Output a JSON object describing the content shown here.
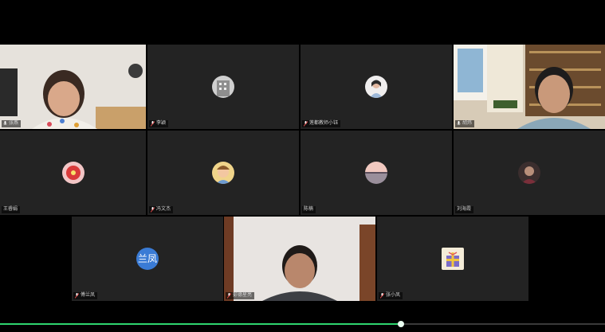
{
  "participants": [
    {
      "name": "张燕",
      "muted": false,
      "type": "video"
    },
    {
      "name": "李颖",
      "muted": true,
      "type": "avatar",
      "icon": "building-avatar"
    },
    {
      "name": "莲都教师小钰",
      "muted": true,
      "type": "avatar",
      "icon": "woman-photo-avatar"
    },
    {
      "name": "胡炜",
      "muted": false,
      "type": "video"
    },
    {
      "name": "王睿娟",
      "muted": false,
      "type": "avatar",
      "icon": "red-flower-avatar"
    },
    {
      "name": "冯文杰",
      "muted": true,
      "type": "avatar",
      "icon": "cartoon-child-avatar"
    },
    {
      "name": "陈楠",
      "muted": false,
      "type": "avatar",
      "icon": "sunset-lake-avatar"
    },
    {
      "name": "刘海霞",
      "muted": false,
      "type": "avatar",
      "icon": "dark-photo-avatar"
    },
    {
      "name": "傅兰凤",
      "muted": true,
      "type": "avatar_text",
      "avatar_text": "兰凤"
    },
    {
      "name": "彭德星亮",
      "muted": true,
      "type": "video"
    },
    {
      "name": "张小凤",
      "muted": true,
      "type": "avatar",
      "icon": "gift-box-avatar"
    }
  ],
  "playback": {
    "progress": 0.663
  },
  "colors": {
    "accent": "#2fd56f",
    "tile_bg": "#232323",
    "avatar_text_bg": "#3a7bd5"
  }
}
